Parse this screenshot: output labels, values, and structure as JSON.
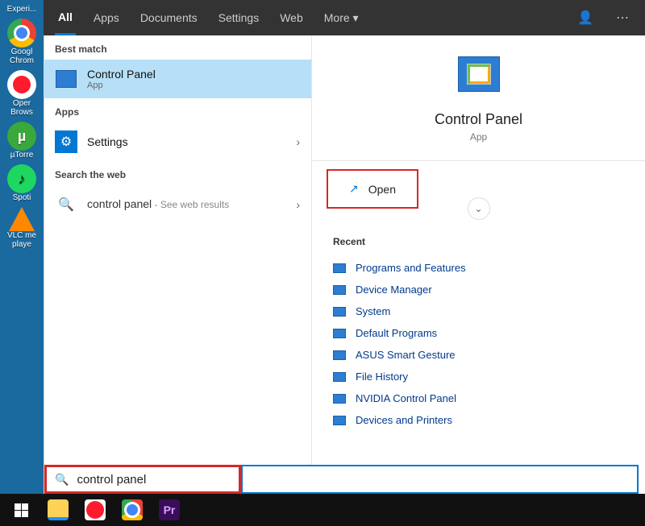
{
  "desktop": {
    "top_label": "Experi...",
    "icons": [
      {
        "name": "Google Chrome",
        "label": "Googl\nChrom"
      },
      {
        "name": "Opera Browser",
        "label": "Oper\nBrows"
      },
      {
        "name": "uTorrent",
        "label": "µTorre"
      },
      {
        "name": "Spotify",
        "label": "Spoti"
      },
      {
        "name": "VLC media player",
        "label": "VLC me\nplaye"
      }
    ]
  },
  "tabs": [
    "All",
    "Apps",
    "Documents",
    "Settings",
    "Web",
    "More"
  ],
  "left": {
    "best_match": "Best match",
    "top": {
      "title": "Control Panel",
      "sub": "App"
    },
    "apps": "Apps",
    "settings_item": "Settings",
    "web_h": "Search the web",
    "web_item": "control panel",
    "web_hint": " - See web results"
  },
  "right": {
    "title": "Control Panel",
    "sub": "App",
    "open": "Open",
    "recent_h": "Recent",
    "recent": [
      "Programs and Features",
      "Device Manager",
      "System",
      "Default Programs",
      "ASUS Smart Gesture",
      "File History",
      "NVIDIA Control Panel",
      "Devices and Printers"
    ]
  },
  "search": {
    "value": "control panel"
  }
}
